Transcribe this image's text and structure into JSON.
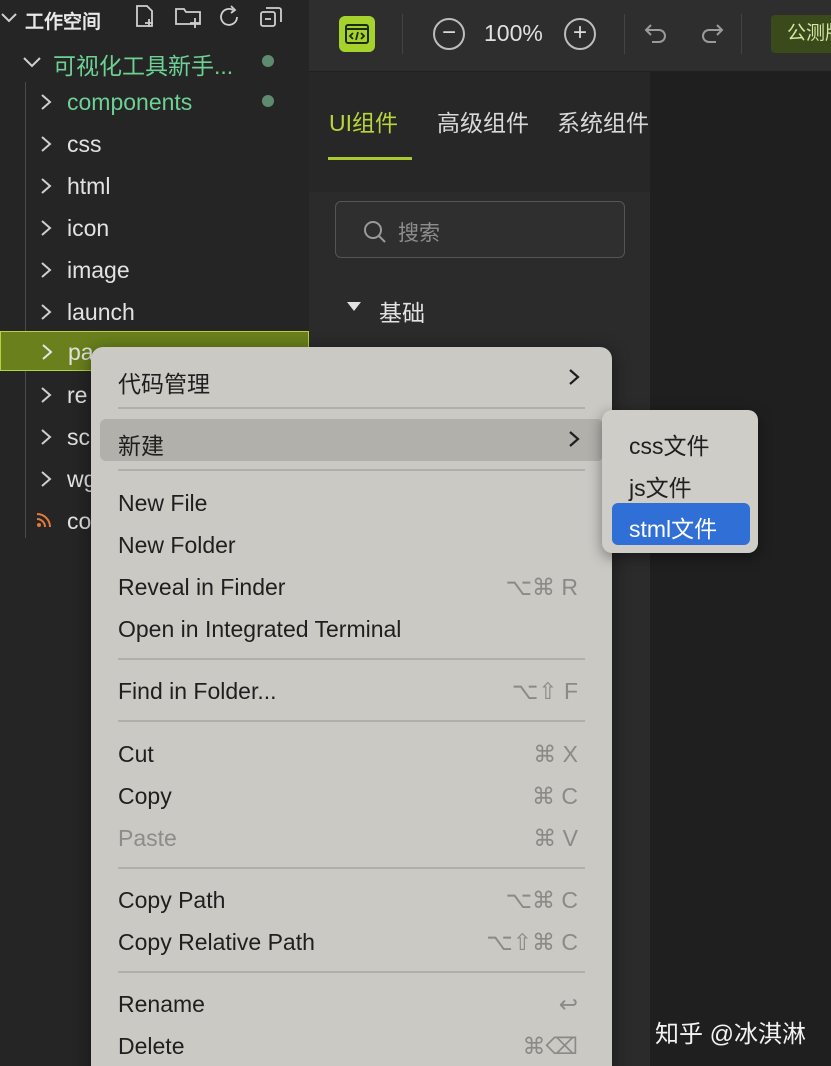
{
  "sidebar": {
    "workspace_title": "工作空间",
    "project_name": "可视化工具新手...",
    "items": [
      {
        "label": "components"
      },
      {
        "label": "css"
      },
      {
        "label": "html"
      },
      {
        "label": "icon"
      },
      {
        "label": "image"
      },
      {
        "label": "launch"
      },
      {
        "label": "pa"
      },
      {
        "label": "re"
      },
      {
        "label": "sc"
      },
      {
        "label": "wg"
      },
      {
        "label": "co"
      }
    ]
  },
  "toolbar": {
    "zoom_out": "−",
    "zoom_level": "100%",
    "zoom_in": "+",
    "beta_label": "公测版"
  },
  "panel": {
    "tabs": [
      {
        "label": "UI组件"
      },
      {
        "label": "高级组件"
      },
      {
        "label": "系统组件"
      }
    ],
    "search_placeholder": "搜索",
    "section_title": "基础"
  },
  "context_menu": {
    "items": [
      {
        "label": "代码管理",
        "shortcut": ""
      },
      {
        "label": "新建",
        "shortcut": ""
      },
      {
        "label": "New File",
        "shortcut": ""
      },
      {
        "label": "New Folder",
        "shortcut": ""
      },
      {
        "label": "Reveal in Finder",
        "shortcut": "⌥⌘ R"
      },
      {
        "label": "Open in Integrated Terminal",
        "shortcut": ""
      },
      {
        "label": "Find in Folder...",
        "shortcut": "⌥⇧ F"
      },
      {
        "label": "Cut",
        "shortcut": "⌘ X"
      },
      {
        "label": "Copy",
        "shortcut": "⌘ C"
      },
      {
        "label": "Paste",
        "shortcut": "⌘ V"
      },
      {
        "label": "Copy Path",
        "shortcut": "⌥⌘ C"
      },
      {
        "label": "Copy Relative Path",
        "shortcut": "⌥⇧⌘ C"
      },
      {
        "label": "Rename",
        "shortcut": "↩"
      },
      {
        "label": "Delete",
        "shortcut": "⌘⌫"
      }
    ]
  },
  "submenu": {
    "items": [
      {
        "label": "css文件"
      },
      {
        "label": "js文件"
      },
      {
        "label": "stml文件"
      }
    ]
  },
  "watermark": "知乎 @冰淇淋",
  "colors": {
    "accent": "#a9cb2d",
    "tree_green": "#6cd193",
    "selection_blue": "#2f6fd6"
  }
}
